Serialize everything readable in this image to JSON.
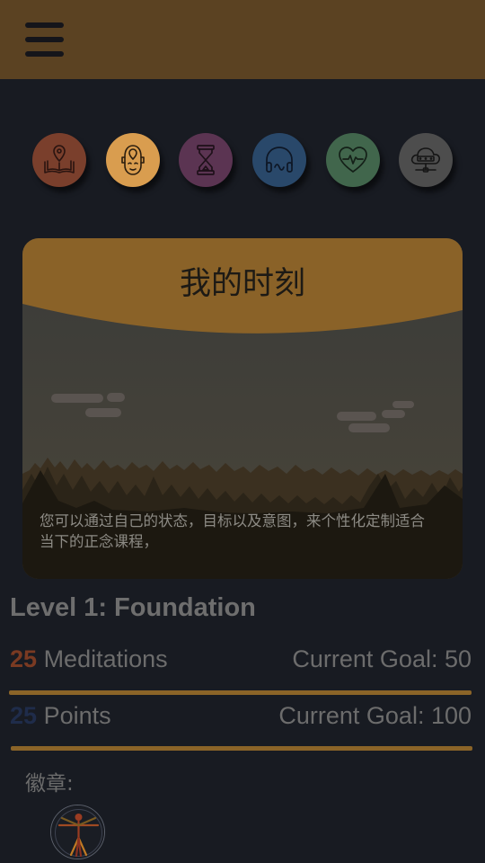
{
  "header": {
    "menu_icon": "hamburger-menu-icon",
    "background_color": "#5b4222"
  },
  "categories": [
    {
      "icon": "map-book-icon",
      "color": "#7a3f2c"
    },
    {
      "icon": "head-focus-icon",
      "color": "#d99d4f"
    },
    {
      "icon": "hourglass-icon",
      "color": "#5b3452"
    },
    {
      "icon": "headphones-icon",
      "color": "#29486a"
    },
    {
      "icon": "heart-pulse-icon",
      "color": "#41664c"
    },
    {
      "icon": "cloud-network-icon",
      "color": "#4d4d4d"
    }
  ],
  "card": {
    "title": "我的时刻",
    "description": "您可以通过自己的状态，目标以及意图，来个性化定制适合当下的正念课程，"
  },
  "progress": {
    "level_title": "Level 1: Foundation",
    "meditations": {
      "count": "25",
      "label": "Meditations",
      "goal": "Current Goal: 50",
      "count_color": "#7a3a22"
    },
    "points": {
      "count": "25",
      "label": "Points",
      "goal": "Current Goal: 100",
      "count_color": "#1f2c4a"
    }
  },
  "badges": {
    "label": "徽章:",
    "items": [
      {
        "icon": "vitruvian-man-badge-icon"
      }
    ]
  }
}
